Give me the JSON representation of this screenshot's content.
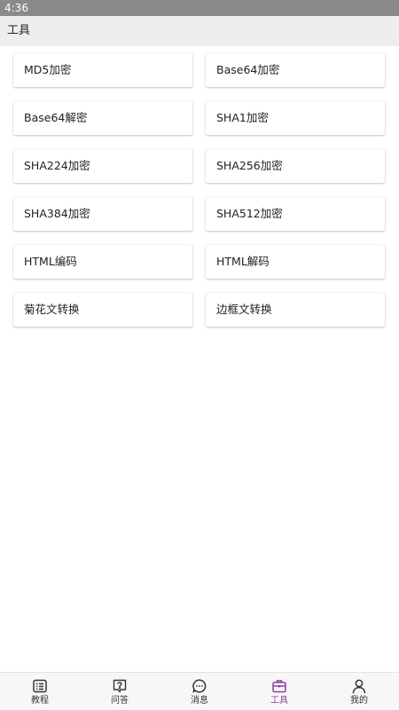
{
  "status_bar": {
    "time": "4:36"
  },
  "app_bar": {
    "title": "工具"
  },
  "tools": [
    {
      "label": "MD5加密"
    },
    {
      "label": "Base64加密"
    },
    {
      "label": "Base64解密"
    },
    {
      "label": "SHA1加密"
    },
    {
      "label": "SHA224加密"
    },
    {
      "label": "SHA256加密"
    },
    {
      "label": "SHA384加密"
    },
    {
      "label": "SHA512加密"
    },
    {
      "label": "HTML编码"
    },
    {
      "label": "HTML解码"
    },
    {
      "label": "菊花文转换"
    },
    {
      "label": "边框文转换"
    }
  ],
  "tab_bar": {
    "active_color": "#8e3ea0",
    "items": [
      {
        "label": "教程",
        "icon": "tutorial-icon"
      },
      {
        "label": "问答",
        "icon": "question-icon"
      },
      {
        "label": "消息",
        "icon": "message-icon"
      },
      {
        "label": "工具",
        "icon": "toolbox-icon"
      },
      {
        "label": "我的",
        "icon": "profile-icon"
      }
    ]
  }
}
